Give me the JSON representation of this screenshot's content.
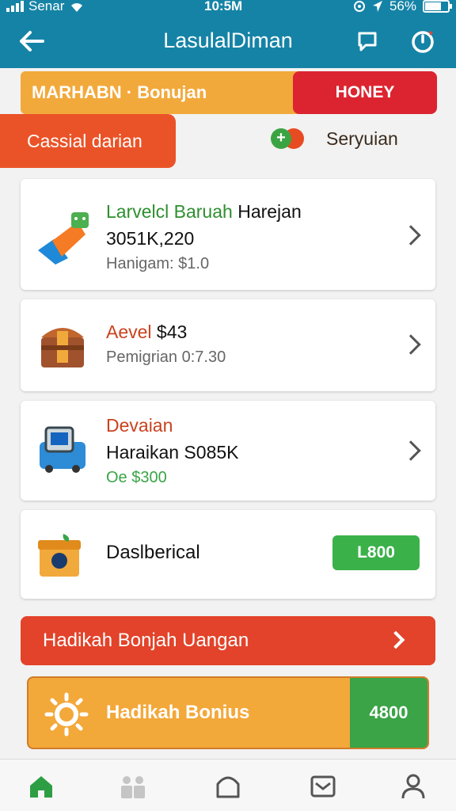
{
  "status_bar": {
    "carrier": "Senar",
    "time": "10:5M",
    "battery": "56%"
  },
  "header": {
    "title": "LasulalDiman"
  },
  "promo": {
    "yellow_label": "MARHABN · Bonujan",
    "red_label": "HONEY",
    "orange_label": "Cassial darian",
    "service_label": "Seryuian",
    "service_plus": "+"
  },
  "cards": [
    {
      "title_green": "Larvelcl Baruah",
      "title_rest": " Harejan",
      "line2": "3051K,220",
      "line3": "Hanigam: $1.0"
    },
    {
      "title_colored": "Aevel",
      "title_rest": " $43",
      "line3": "Pemigrian 0:7.30"
    },
    {
      "title_colored": "Devaian",
      "line2": "Haraikan S085K",
      "line3": "Oe $300"
    },
    {
      "title": "Daslberical",
      "button": "L800"
    }
  ],
  "banner_red": {
    "label": "Hadikah Bonjah Uangan"
  },
  "banner_bonus": {
    "label": "Hadikah Bonius",
    "value": "4800"
  },
  "colors": {
    "header_bg": "#1583a6",
    "green": "#3bb14a",
    "orange": "#ea5327",
    "red": "#dc2430",
    "yellow": "#f2a93b"
  }
}
